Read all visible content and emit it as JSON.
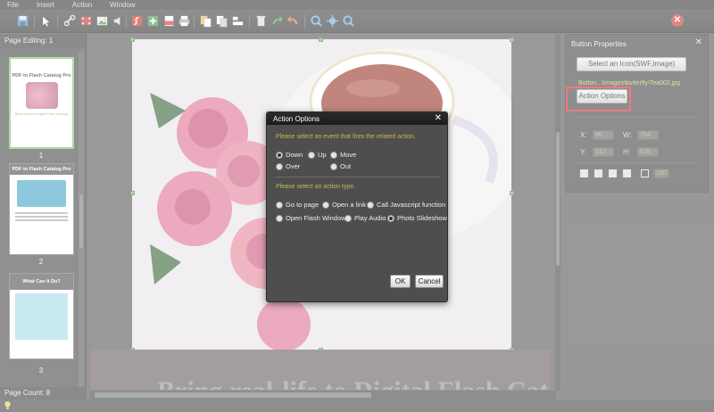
{
  "menu": [
    "File",
    "Insert",
    "Action",
    "Window"
  ],
  "toolbar": {
    "icons": [
      "save-icon",
      "pointer-icon",
      "link-icon",
      "video-icon",
      "image-icon",
      "audio-icon",
      "flash-icon",
      "add-icon",
      "pdf-icon",
      "print-icon",
      "copy-icon",
      "paste-icon",
      "align-icon",
      "delete-icon",
      "redo-icon",
      "undo-icon",
      "zoom-in-icon",
      "fit-icon",
      "zoom-out-icon"
    ]
  },
  "left_panel": {
    "header": "Page Editing: 1",
    "footer": "Page Count: 8",
    "thumbs": [
      {
        "title": "PDF to Flash Catalog Pro",
        "subtitle": "Bring real-life to Digital Flash Catalogs",
        "num": "1"
      },
      {
        "title": "PDF to Flash Catalog Pro",
        "num": "2"
      },
      {
        "title": "What Can It Do?",
        "num": "3"
      }
    ]
  },
  "canvas": {
    "bottom_title": "Bring real-life to Digital Flash Catalogs"
  },
  "right_panel": {
    "title": "Button Properties",
    "select_icon_label": "Select an Icon(SWF,Image)",
    "icon_path": "Button...\\Images\\butterfly\\Tea002.jpg",
    "action_options_label": "Action Options",
    "x_label": "X:",
    "x_value": "86",
    "w_label": "W:",
    "w_value": "764",
    "y_label": "Y:",
    "y_value": "312",
    "h_label": "H:",
    "h_value": "629",
    "opacity_value": "100"
  },
  "dialog": {
    "title": "Action Options",
    "event_hint": "Please select an event that fires the related action.",
    "events": [
      "Down",
      "Up",
      "Move",
      "Over",
      "Out"
    ],
    "selected_event": "Down",
    "action_hint": "Please select an action type.",
    "actions": [
      "Go to page",
      "Open a link",
      "Call Javascript function",
      "Open Flash Window",
      "Play Audio",
      "Photo Slideshow"
    ],
    "selected_action": "Photo Slideshow",
    "ok_label": "OK",
    "cancel_label": "Cancel"
  },
  "colors": {
    "accent_green": "#7ec36b",
    "highlight_red": "#e02a2a",
    "hint_yellow": "#c6b951"
  }
}
